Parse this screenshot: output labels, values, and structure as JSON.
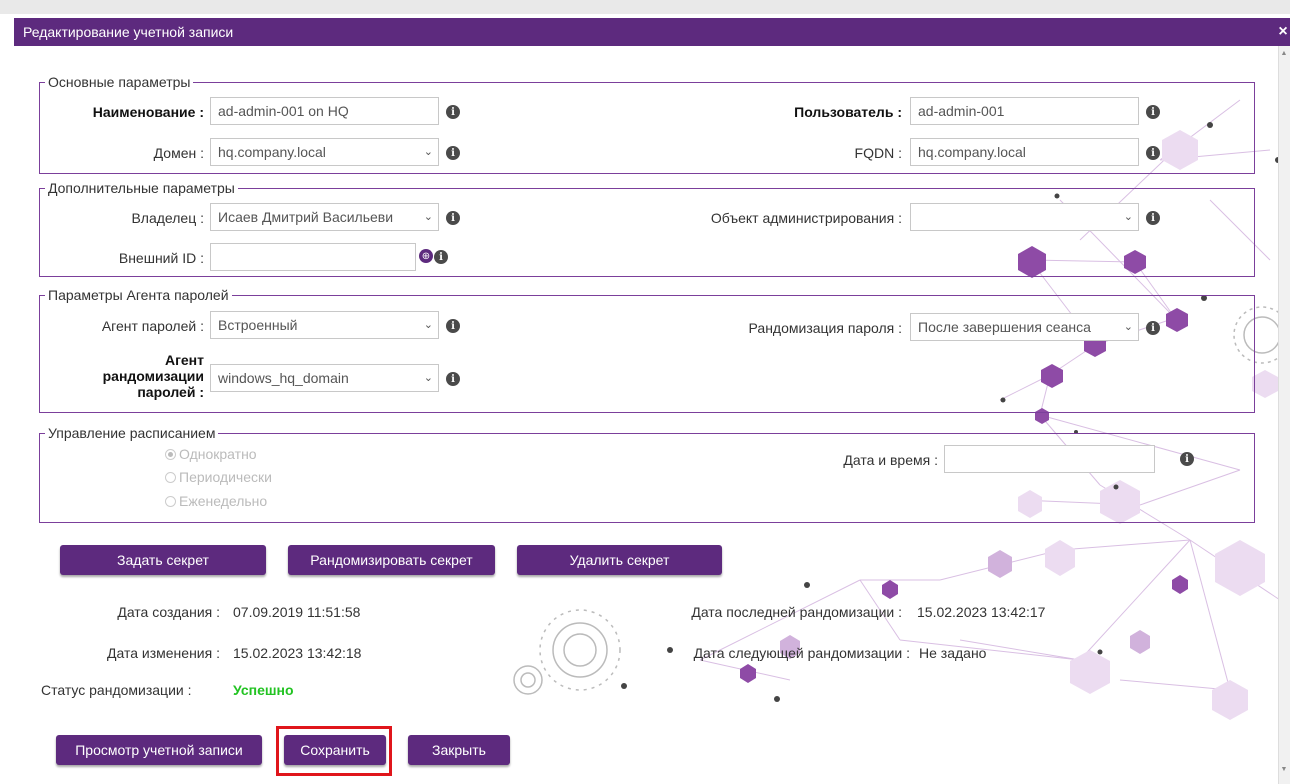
{
  "dialog": {
    "title": "Редактирование учетной записи",
    "close_glyph": "×"
  },
  "main_params": {
    "legend": "Основные параметры",
    "name_label": "Наименование :",
    "name_value": "ad-admin-001 on HQ",
    "domain_label": "Домен :",
    "domain_value": "hq.company.local",
    "user_label": "Пользователь :",
    "user_value": "ad-admin-001",
    "fqdn_label": "FQDN :",
    "fqdn_value": "hq.company.local"
  },
  "extra_params": {
    "legend": "Дополнительные параметры",
    "owner_label": "Владелец :",
    "owner_value": "Исаев Дмитрий Васильеви",
    "external_id_label": "Внешний ID :",
    "external_id_value": "",
    "admin_object_label": "Объект администрирования :",
    "admin_object_value": ""
  },
  "agent_params": {
    "legend": "Параметры Агента паролей",
    "agent_label": "Агент паролей :",
    "agent_value": "Встроенный",
    "rand_agent_label_1": "Агент",
    "rand_agent_label_2": "рандомизации",
    "rand_agent_label_3": "паролей :",
    "rand_agent_value": "windows_hq_domain",
    "rand_label": "Рандомизация пароля :",
    "rand_value": "После завершения сеанса"
  },
  "schedule": {
    "legend": "Управление расписанием",
    "options": [
      "Однократно",
      "Периодически",
      "Еженедельно"
    ],
    "selected_index": 0,
    "datetime_label": "Дата и время :",
    "datetime_value": ""
  },
  "secret_buttons": {
    "set": "Задать секрет",
    "randomize": "Рандомизировать секрет",
    "delete": "Удалить секрет"
  },
  "info": {
    "created_label": "Дата создания :",
    "created_value": "07.09.2019 11:51:58",
    "modified_label": "Дата изменения :",
    "modified_value": "15.02.2023 13:42:18",
    "status_label": "Статус рандомизации :",
    "status_value": "Успешно",
    "last_rand_label": "Дата последней рандомизации :",
    "last_rand_value": "15.02.2023 13:42:17",
    "next_rand_label": "Дата следующей рандомизации :",
    "next_rand_value": "Не задано"
  },
  "footer_buttons": {
    "view": "Просмотр учетной записи",
    "save": "Сохранить",
    "close": "Закрыть"
  },
  "icons": {
    "info": "i",
    "caret": "⌄",
    "globe": "⊕",
    "scroll_up": "▲",
    "scroll_down": "▼"
  },
  "colors": {
    "brand": "#5d2a7e",
    "success": "#22c322",
    "highlight": "#e0151b",
    "decor": "#8e4ba6"
  }
}
